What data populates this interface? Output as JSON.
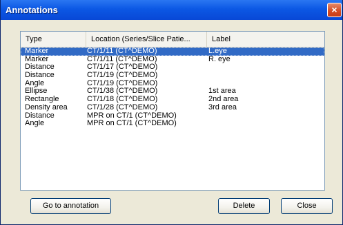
{
  "dialog": {
    "title": "Annotations",
    "close_glyph": "×"
  },
  "list": {
    "columns": [
      "Type",
      "Location (Series/Slice Patie...",
      "Label"
    ],
    "rows": [
      {
        "type": "Marker",
        "location": "CT/1/11  (CT^DEMO)",
        "label": "L.eye",
        "selected": true
      },
      {
        "type": "Marker",
        "location": "CT/1/11  (CT^DEMO)",
        "label": "R. eye"
      },
      {
        "type": "Distance",
        "location": "CT/1/17  (CT^DEMO)",
        "label": ""
      },
      {
        "type": "Distance",
        "location": "CT/1/19  (CT^DEMO)",
        "label": ""
      },
      {
        "type": "Angle",
        "location": "CT/1/19  (CT^DEMO)",
        "label": ""
      },
      {
        "type": "Ellipse",
        "location": "CT/1/38  (CT^DEMO)",
        "label": "1st area"
      },
      {
        "type": "Rectangle",
        "location": "CT/1/18  (CT^DEMO)",
        "label": "2nd area"
      },
      {
        "type": "Density area",
        "location": "CT/1/28  (CT^DEMO)",
        "label": "3rd area"
      },
      {
        "type": "Distance",
        "location": "MPR on CT/1  (CT^DEMO)",
        "label": ""
      },
      {
        "type": "Angle",
        "location": "MPR on CT/1  (CT^DEMO)",
        "label": ""
      }
    ]
  },
  "buttons": {
    "goto": "Go to annotation",
    "delete": "Delete",
    "close": "Close"
  },
  "colors": {
    "selection": "#316ac5",
    "titlebar": "#0c58e4"
  }
}
